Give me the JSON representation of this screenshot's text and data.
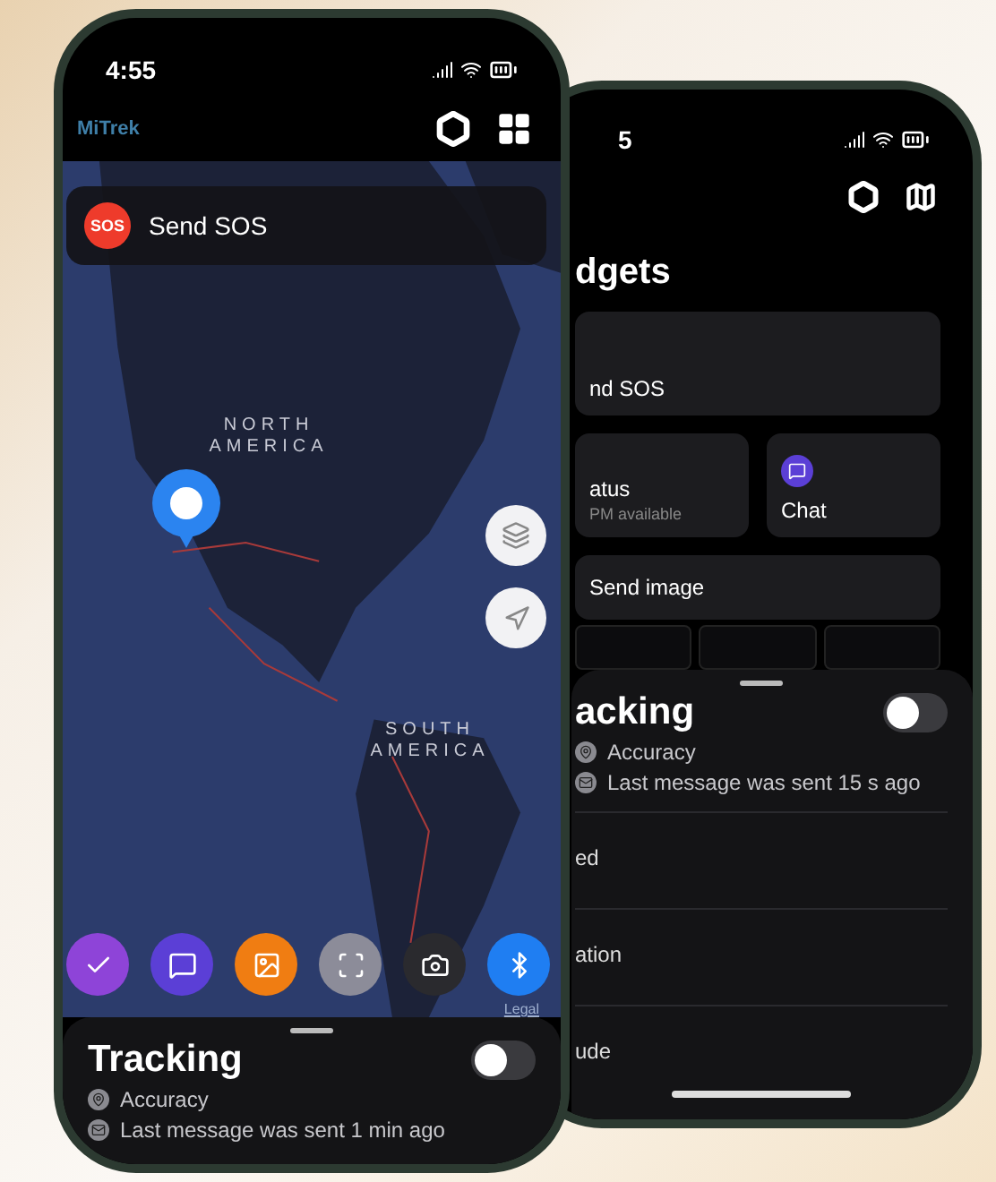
{
  "front_phone": {
    "status_bar": {
      "time": "4:55"
    },
    "header": {
      "logo": "MiTrek"
    },
    "sos_card": {
      "badge": "SOS",
      "label": "Send SOS"
    },
    "map": {
      "labels": [
        {
          "text": "NORTH AMERICA",
          "kind": "continent"
        },
        {
          "text": "SOUTH AMERICA",
          "kind": "continent"
        }
      ],
      "legal": "Legal"
    },
    "quick_actions": [
      {
        "kind": "check",
        "color": "#8e44d8"
      },
      {
        "kind": "chat",
        "color": "#5b3fd6"
      },
      {
        "kind": "image",
        "color": "#f07d12"
      },
      {
        "kind": "scan",
        "color": "#8c8c99"
      },
      {
        "kind": "camera",
        "color": "#2a2a2e"
      },
      {
        "kind": "bluetooth",
        "color": "#1f7ef2"
      }
    ],
    "tracking": {
      "title": "Tracking",
      "enabled": false,
      "lines": [
        {
          "kind": "accuracy",
          "text": "Accuracy"
        },
        {
          "kind": "message",
          "text": "Last message was sent 1 min ago"
        }
      ]
    }
  },
  "back_phone": {
    "status_bar": {
      "time": "5"
    },
    "title": "dgets",
    "widgets": [
      {
        "kind": "wide",
        "label": "nd SOS"
      },
      {
        "kind": "half",
        "label": "atus",
        "sub": "PM available"
      },
      {
        "kind": "half",
        "label": "Chat",
        "color": "#5b3fd6"
      },
      {
        "kind": "row",
        "label": "Send image"
      }
    ],
    "tracking": {
      "title": "acking",
      "enabled": false,
      "lines": [
        {
          "kind": "accuracy",
          "text": "Accuracy"
        },
        {
          "kind": "message",
          "text": "Last message was sent 15 s ago"
        }
      ]
    },
    "settings": [
      "ed",
      "ation",
      "ude"
    ]
  }
}
